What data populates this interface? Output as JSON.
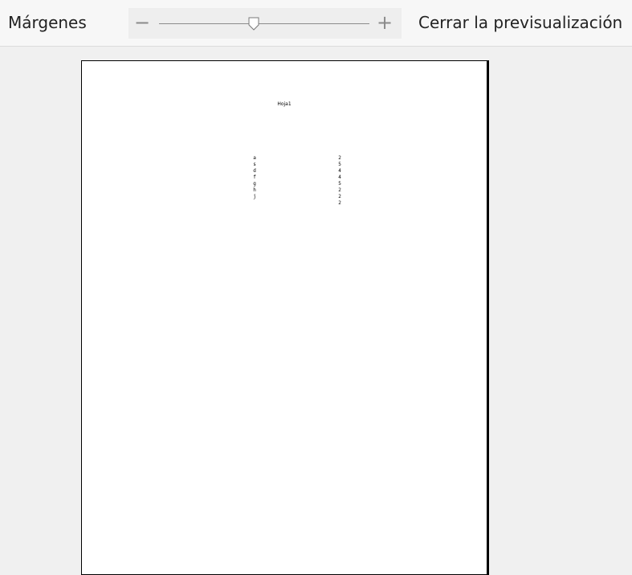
{
  "toolbar": {
    "margins_label": "Márgenes",
    "zoom": {
      "minus_label": "−",
      "plus_label": "+",
      "level": 0.45
    },
    "close_preview_label": "Cerrar la previsualización"
  },
  "page": {
    "header_text": "Hoja1",
    "column_a": [
      "a",
      "s",
      "d",
      "f",
      "g",
      "h",
      "j"
    ],
    "column_b": [
      "2",
      "5",
      "4",
      "4",
      "5",
      "2",
      "2",
      "2"
    ]
  },
  "colors": {
    "toolbar_bg": "#f7f7f7",
    "preview_bg": "#f0f0f0",
    "page_bg": "#ffffff",
    "page_border": "#000000"
  }
}
